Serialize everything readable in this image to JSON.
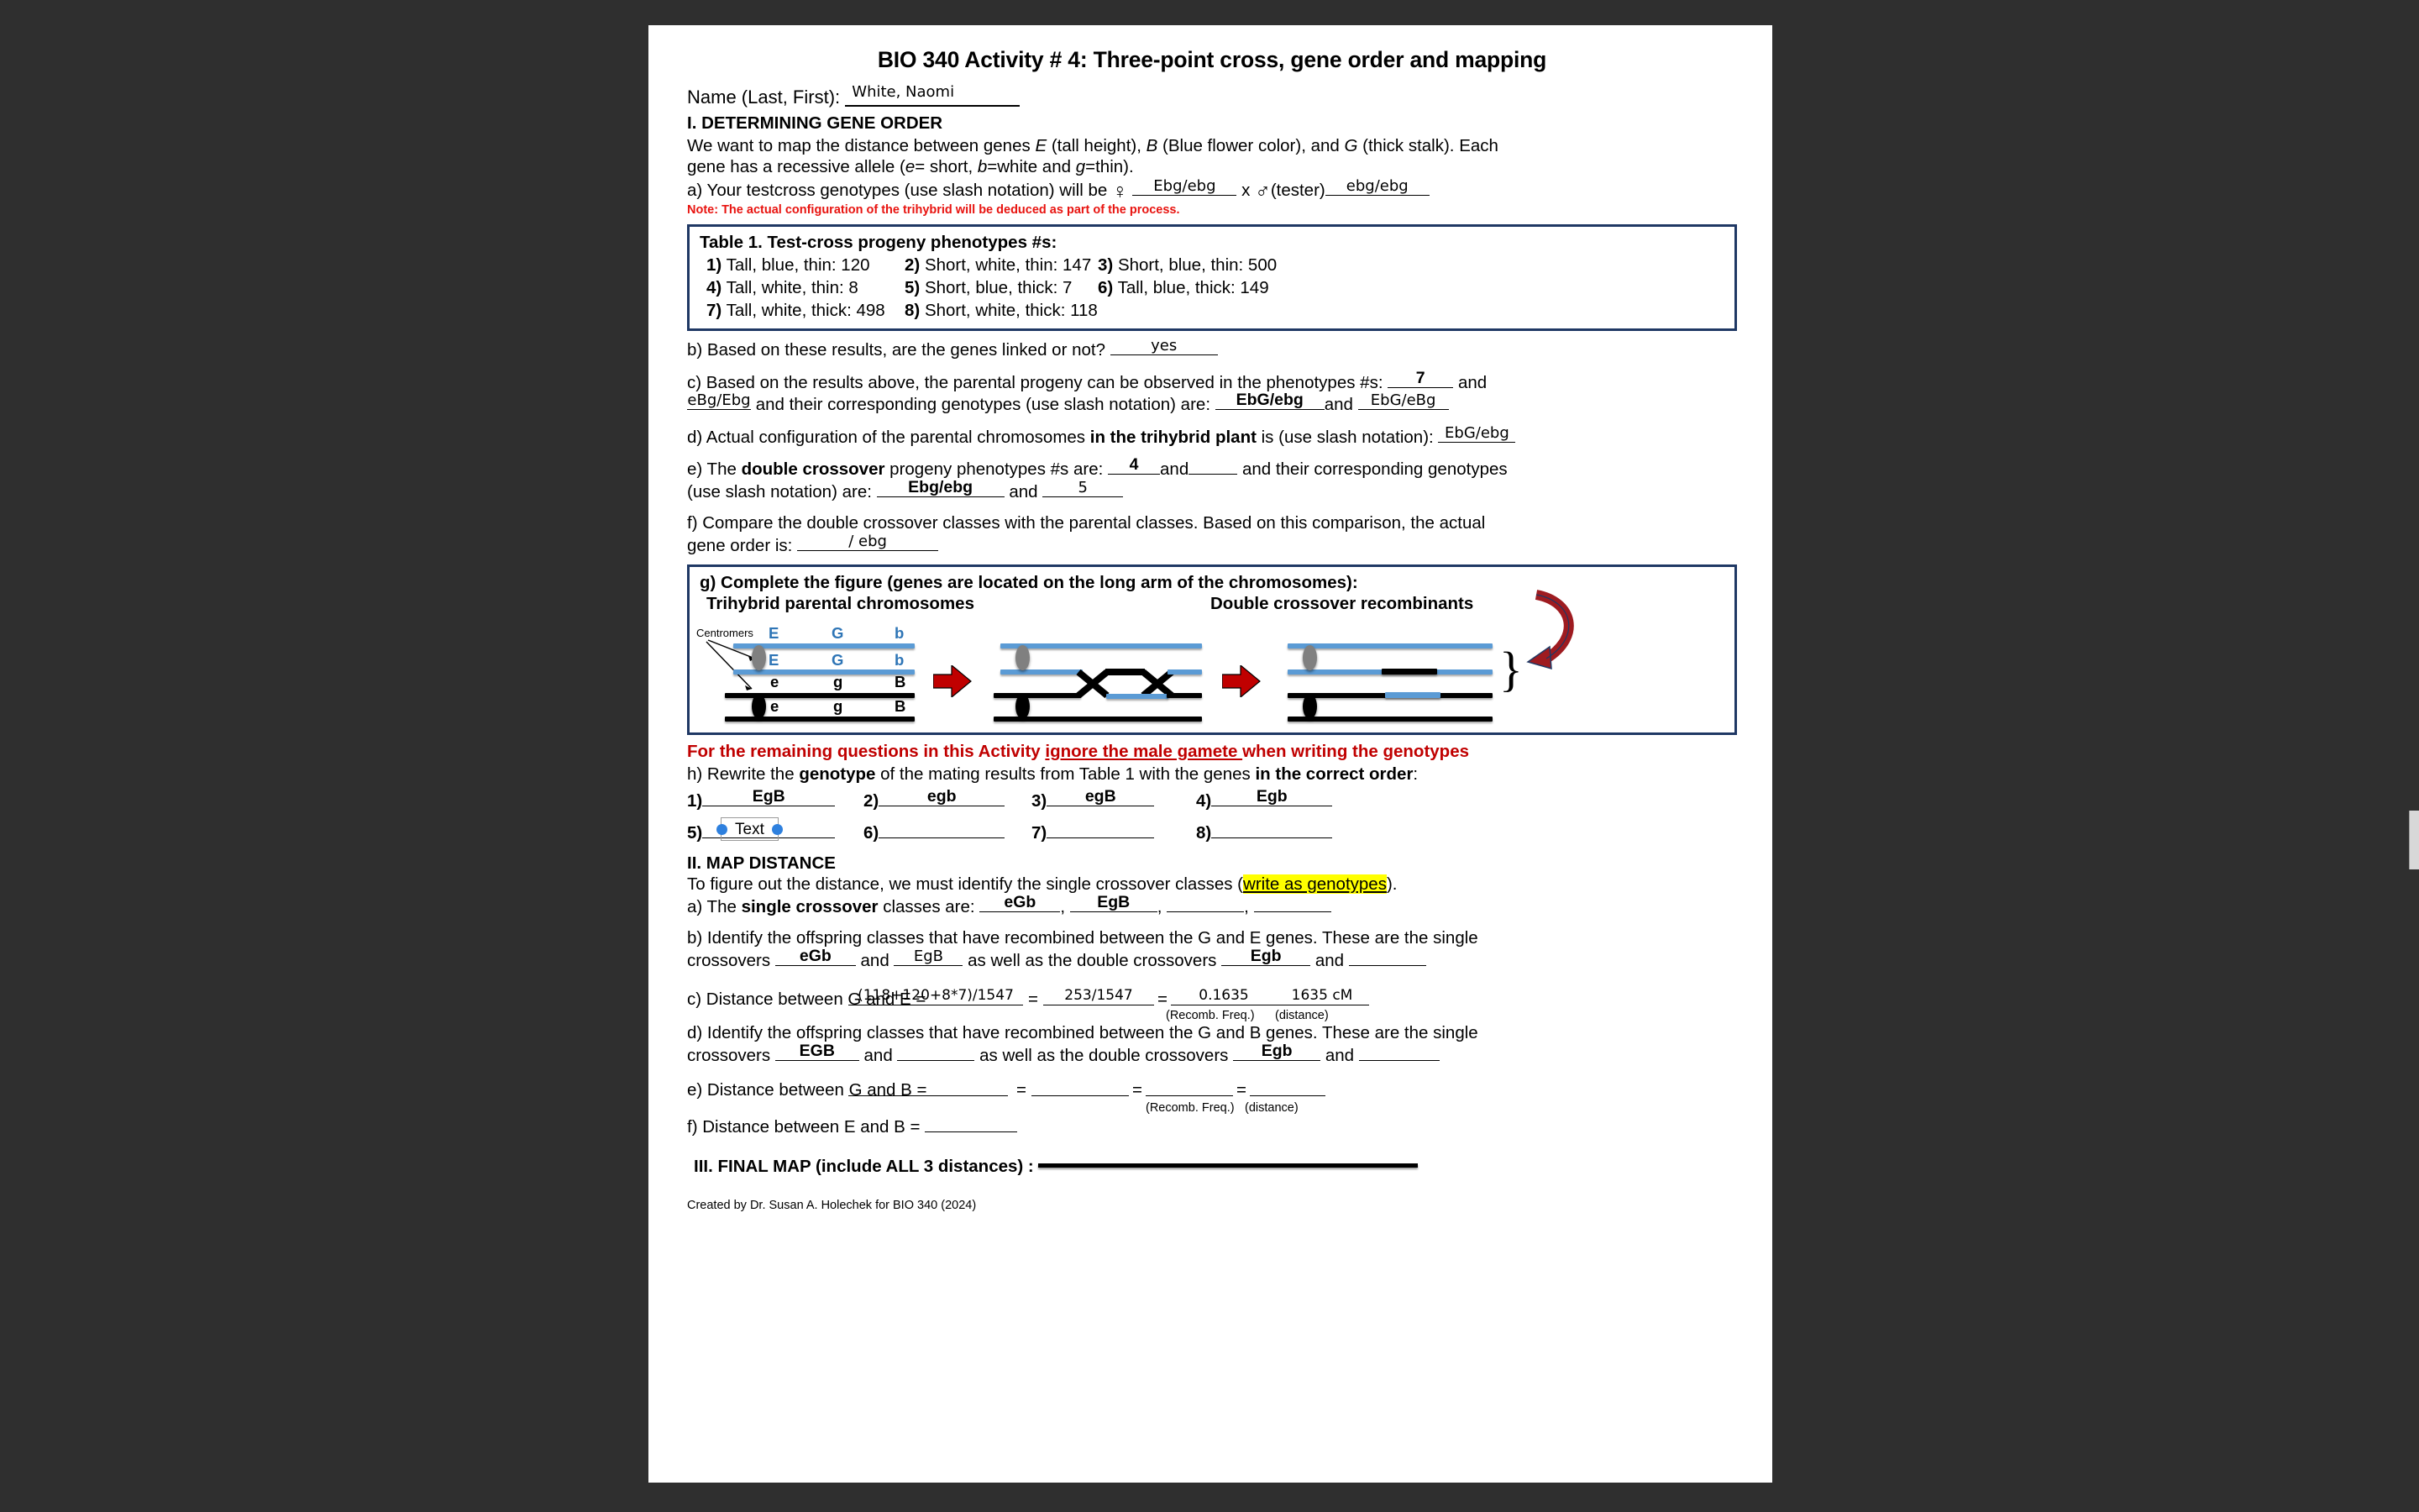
{
  "document": {
    "title": "BIO 340 Activity # 4: Three-point cross, gene order and mapping",
    "name_label": "Name (Last, First):",
    "name_value": "White, Naomi",
    "credit": "Created by Dr. Susan A. Holechek for BIO 340 (2024)"
  },
  "section_1": {
    "heading": "I. DETERMINING GENE ORDER",
    "intro_line1": "We want to map the distance between genes ",
    "intro_E": "E",
    "intro_E_desc": " (tall height), ",
    "intro_B": "B",
    "intro_B_desc": " (Blue flower color), and ",
    "intro_G": "G",
    "intro_G_desc": " (thick stalk). Each",
    "intro_line2_pre": "gene has a recessive allele (",
    "intro_e": "e",
    "intro_e_desc": "= short, ",
    "intro_b": "b",
    "intro_b_desc": "=white and ",
    "intro_g": "g",
    "intro_g_desc": "=thin).",
    "a_label": "a) Your testcross genotypes (use slash notation) will be",
    "a_female_glyph": "♀",
    "a_female_value": "Ebg/ebg",
    "a_cross": "x",
    "a_male_glyph": "♂",
    "a_male_label": "(tester)",
    "a_male_value": "ebg/ebg",
    "note": "Note: The actual configuration of the trihybrid will be deduced as part of the process."
  },
  "table1": {
    "caption": "Table 1. Test-cross progeny phenotypes #s:",
    "rows": [
      {
        "n": "1)",
        "text": "Tall, blue, thin: 120"
      },
      {
        "n": "2)",
        "text": "Short, white, thin: 147"
      },
      {
        "n": "3)",
        "text": "Short, blue, thin: 500"
      },
      {
        "n": "4)",
        "text": "Tall, white, thin: 8"
      },
      {
        "n": "5)",
        "text": "Short, blue, thick: 7"
      },
      {
        "n": "6)",
        "text": "Tall, blue, thick: 149"
      },
      {
        "n": "7)",
        "text": "Tall, white, thick: 498"
      },
      {
        "n": "8)",
        "text": "Short, white, thick: 118"
      }
    ]
  },
  "questions_1": {
    "b_text": "b) Based on these results, are the genes linked or not?",
    "b_answer": "yes",
    "c_text_1": "c) Based on the results above, the parental progeny can be observed in the phenotypes #s:",
    "c_answer_1": "7",
    "c_and_1": "and",
    "c_answer_2": "eBg/Ebg",
    "c_text_2": "and their corresponding genotypes (use slash notation) are:",
    "c_answer_3": "EbG/ebg",
    "c_and_2": "and",
    "c_answer_4": "EbG/eBg",
    "d_text": "d) Actual configuration of the parental chromosomes ",
    "d_bold": "in the trihybrid plant",
    "d_text_2": " is (use slash notation):",
    "d_answer": "EbG/ebg",
    "e_text_1": "e) The ",
    "e_bold": "double crossover",
    "e_text_2": " progeny phenotypes #s are:",
    "e_answer_1": "4",
    "e_and_1": "and",
    "e_text_3": "and their corresponding genotypes",
    "e_text_4": "(use slash notation) are:",
    "e_answer_2": "Ebg/ebg",
    "e_and_2": "and",
    "e_answer_3": "5",
    "f_text": "f) Compare the double crossover classes with the parental classes. Based on this comparison, the actual",
    "f_text_2": "gene order is:",
    "f_answer": "/ ebg"
  },
  "figure": {
    "g_heading": "g) Complete the figure (genes are located on the long arm of the chromosomes):",
    "left_title": "Trihybrid parental chromosomes",
    "right_title": "Double crossover recombinants",
    "centromers_label": "Centromers",
    "gene_labels_row1": [
      "E",
      "G",
      "b"
    ],
    "gene_labels_row2": [
      "E",
      "G",
      "b"
    ],
    "gene_labels_row3": [
      "e",
      "g",
      "B"
    ],
    "gene_labels_row4": [
      "e",
      "g",
      "B"
    ],
    "x_mark": "X",
    "brace": "}",
    "colors": {
      "blue_chromatid": "#5B9BD5",
      "black_chromatid": "#000000",
      "gene_label_blue": "#2E75B6",
      "arrow_red": "#C00000",
      "curved_arrow_red": "#9E1B20",
      "centromere_gray": "#808080"
    }
  },
  "section_h": {
    "red_notice_pre": "For the remaining questions in this Activity ",
    "red_notice_underline": "ignore the male gamete ",
    "red_notice_post": "when writing the genotypes",
    "h_text_1": "h) Rewrite the ",
    "h_bold_1": "genotype",
    "h_text_2": " of the mating results from Table 1 with the genes ",
    "h_bold_2": "in the correct order",
    "h_text_3": ":",
    "answers": [
      {
        "n": "1)",
        "value": "EgB"
      },
      {
        "n": "2)",
        "value": "egb"
      },
      {
        "n": "3)",
        "value": "egB"
      },
      {
        "n": "4)",
        "value": "Egb"
      },
      {
        "n": "5)",
        "value": ""
      },
      {
        "n": "6)",
        "value": ""
      },
      {
        "n": "7)",
        "value": ""
      },
      {
        "n": "8)",
        "value": ""
      }
    ],
    "placeholder_widget_text": "Text"
  },
  "section_2": {
    "heading": "II. MAP DISTANCE",
    "intro_pre": "To figure out the distance, we must identify the single crossover classes (",
    "intro_highlight": "write as genotypes",
    "intro_post": ").",
    "a_text_1": "a) The ",
    "a_bold": "single crossover",
    "a_text_2": " classes are:",
    "a_answer_1": "eGb",
    "a_answer_2": "EgB",
    "a_answer_3": "",
    "a_answer_4": "",
    "b_text": "b) Identify the offspring classes that have recombined between the G and E genes. These are the single",
    "b_text_2": "crossovers",
    "b_answer_1": "eGb",
    "b_and_1": "and",
    "b_answer_2": "EgB",
    "b_text_3": "as well as the double crossovers",
    "b_answer_3": "Egb",
    "b_and_2": "and",
    "b_answer_4": "",
    "c_text": "c) Distance between G and E =",
    "c_numerator": "(118+120+8*7)/1547",
    "c_eq1": "=",
    "c_value_1": "253/1547",
    "c_eq2": "=",
    "c_value_2": "0.1635",
    "c_value_3": "1635 cM",
    "c_sub_1": "(Recomb. Freq.)",
    "c_sub_2": "(distance)",
    "d_text": "d) Identify the offspring classes that have recombined between the G and B genes. These are the single",
    "d_text_2": "crossovers",
    "d_answer_1": "EGB",
    "d_and_1": "and",
    "d_answer_2": "",
    "d_text_3": "as well as the double crossovers",
    "d_answer_3": "Egb",
    "d_and_2": "and",
    "d_answer_4": "",
    "e_text": "e) Distance between G and B =",
    "e_eq1": "=",
    "e_eq2": "=",
    "e_eq3": "=",
    "e_sub_1": "(Recomb. Freq.)",
    "e_sub_2": "(distance)",
    "f_text": "f) Distance between E and B ="
  },
  "section_3": {
    "heading": "III. FINAL MAP (include ALL 3 distances) :"
  }
}
